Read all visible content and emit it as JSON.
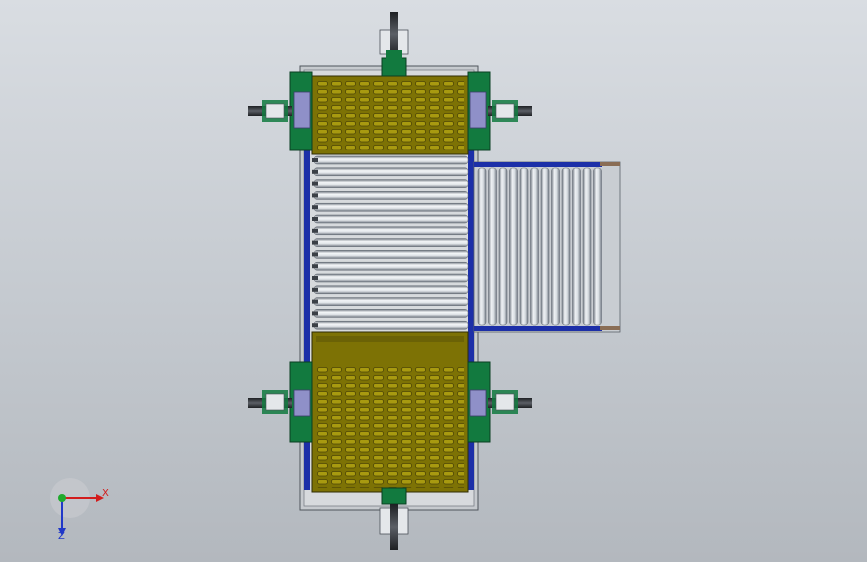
{
  "viewport": {
    "background_top": "#d9dde2",
    "background_bottom": "#b3b8be"
  },
  "model": {
    "colors": {
      "frame_blue": "#1c2fa8",
      "bracket_green": "#127a3f",
      "plate_olive": "#7d7205",
      "plate_slot": "#5a5208",
      "roller_light": "#f2f4f6",
      "roller_dark": "#7e8590",
      "cylinder_dark": "#2d2f33",
      "rail_gray": "#9aa0a7"
    },
    "icons": [
      "lift-cylinder-icon",
      "roller-conveyor-icon",
      "slotted-plate-icon"
    ]
  },
  "triad": {
    "x_label": "X",
    "z_label": "Z",
    "x_color": "#d21c1c",
    "y_color": "#1faa2c",
    "z_color": "#2038c8"
  }
}
